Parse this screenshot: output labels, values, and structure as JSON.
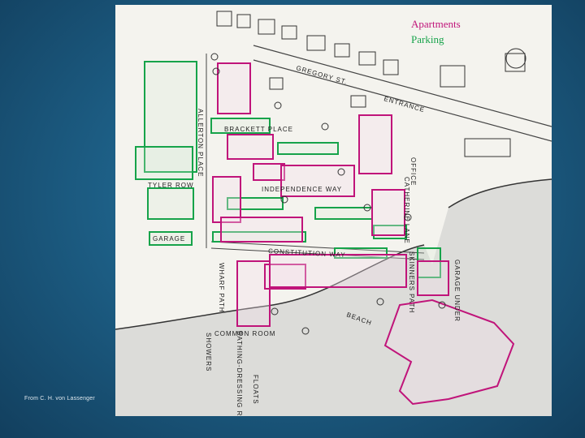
{
  "legend": {
    "apartments": "Apartments",
    "parking": "Parking",
    "apartments_color": "#c0147a",
    "parking_color": "#16a34a"
  },
  "credit": "From C. H. von Lassenger",
  "map_labels": {
    "gregory_st": "GREGORY ST.",
    "entrance": "ENTRANCE",
    "allerton_place": "ALLERTON PLACE",
    "brackett_place": "BRACKETT PLACE",
    "tyler_row": "TYLER ROW",
    "garage": "GARAGE",
    "independence_way": "INDEPENDENCE WAY",
    "catherine_lane": "CATHERINE LANE",
    "office": "OFFICE",
    "constitution_way": "CONSTITUTION WAY",
    "wharf_path": "WHARF PATH",
    "skinners_path": "SKINNERS PATH",
    "garage_under": "GARAGE UNDER",
    "common_room": "COMMON ROOM",
    "bathing_dressing": "BATHING-DRESSING ROOMS",
    "showers": "SHOWERS",
    "beach": "BEACH",
    "floats": "FLOATS"
  }
}
